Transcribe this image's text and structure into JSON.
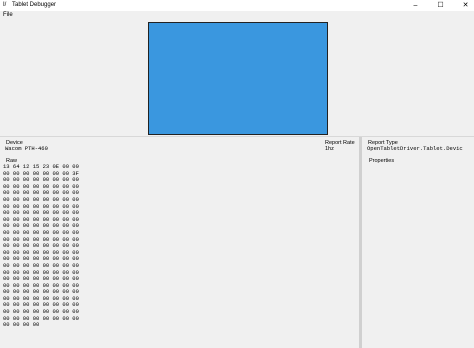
{
  "window": {
    "title": "Tablet Debugger",
    "icon": "tablet-app-icon",
    "minimize": "–",
    "maximize": "☐",
    "close": "✕"
  },
  "menu": {
    "file": "File"
  },
  "tablet_area": {
    "color": "#3a97df"
  },
  "device": {
    "label": "Device",
    "value": "Wacom PTH-460"
  },
  "report_rate": {
    "label": "Report Rate",
    "value": "1hz"
  },
  "report_type": {
    "label": "Report Type",
    "value": "OpenTabletDriver.Tablet.Devic"
  },
  "properties": {
    "label": "Properties"
  },
  "raw": {
    "label": "Raw",
    "lines": [
      "13 64 12 15 23 0E 00 00",
      "00 00 00 00 00 00 00 3F",
      "00 00 00 00 00 00 00 00",
      "00 00 00 00 00 00 00 00",
      "00 00 00 00 00 00 00 00",
      "00 00 00 00 00 00 00 00",
      "00 00 00 00 00 00 00 00",
      "00 00 00 00 00 00 00 00",
      "00 00 00 00 00 00 00 00",
      "00 00 00 00 00 00 00 00",
      "00 00 00 00 00 00 00 00",
      "00 00 00 00 00 00 00 00",
      "00 00 00 00 00 00 00 00",
      "00 00 00 00 00 00 00 00",
      "00 00 00 00 00 00 00 00",
      "00 00 00 00 00 00 00 00",
      "00 00 00 00 00 00 00 00",
      "00 00 00 00 00 00 00 00",
      "00 00 00 00 00 00 00 00",
      "00 00 00 00 00 00 00 00",
      "00 00 00 00 00 00 00 00",
      "00 00 00 00 00 00 00 00",
      "00 00 00 00 00 00 00 00",
      "00 00 00 00 00 00 00 00",
      "00 00 00 00"
    ]
  }
}
